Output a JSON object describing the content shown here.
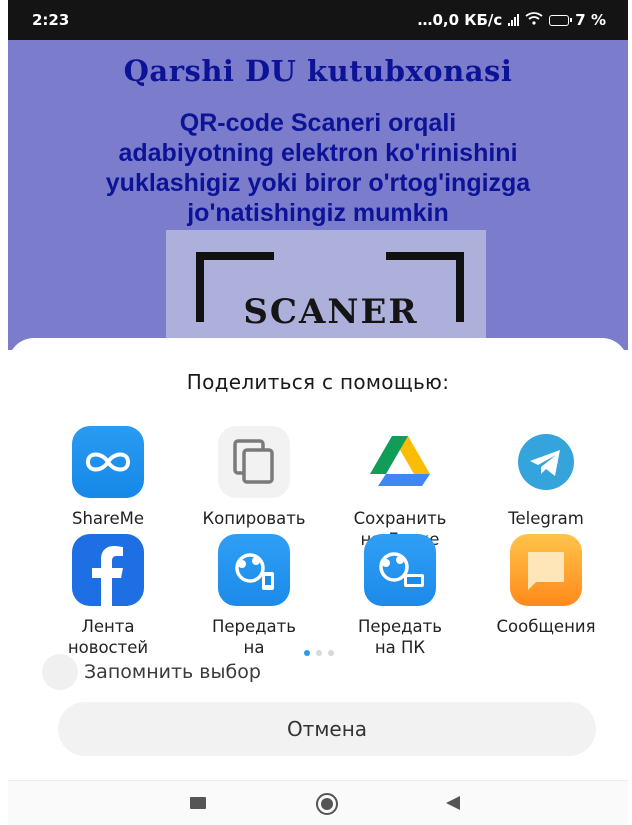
{
  "status_bar": {
    "time": "2:23",
    "network_speed": "…0,0 КБ/с",
    "battery_percent": "7 %"
  },
  "background_app": {
    "title": "Qarshi DU kutubxonasi",
    "description_lines": [
      "QR-code Scaneri orqali",
      "adabiyotning elektron ko'rinishini",
      "yuklashigiz yoki biror o'rtog'ingizga",
      "jo'natishingiz mumkin"
    ],
    "scanner_label": "SCANER"
  },
  "share_sheet": {
    "title": "Поделиться с помощью:",
    "apps": [
      {
        "label_line1": "ShareMe",
        "label_line2": "",
        "icon": "shareme-icon"
      },
      {
        "label_line1": "Копировать",
        "label_line2": "",
        "icon": "copy-icon"
      },
      {
        "label_line1": "Сохранить",
        "label_line2": "на Диске",
        "icon": "google-drive-icon"
      },
      {
        "label_line1": "Telegram",
        "label_line2": "",
        "icon": "telegram-icon"
      },
      {
        "label_line1": "Лента",
        "label_line2": "новостей",
        "icon": "facebook-icon"
      },
      {
        "label_line1": "Передать",
        "label_line2": "на",
        "icon": "transfer-icon"
      },
      {
        "label_line1": "Передать",
        "label_line2": "на ПК",
        "icon": "transfer-pc-icon"
      },
      {
        "label_line1": "Сообщения",
        "label_line2": "",
        "icon": "messages-icon"
      }
    ],
    "page_count": 3,
    "active_page": 1,
    "remember_label": "Запомнить выбор",
    "cancel_label": "Отмена"
  },
  "colors": {
    "status_bar": "#141414",
    "app_background": "#7b7dcc",
    "app_text": "#0c1396",
    "accent": "#2a9bf2"
  }
}
